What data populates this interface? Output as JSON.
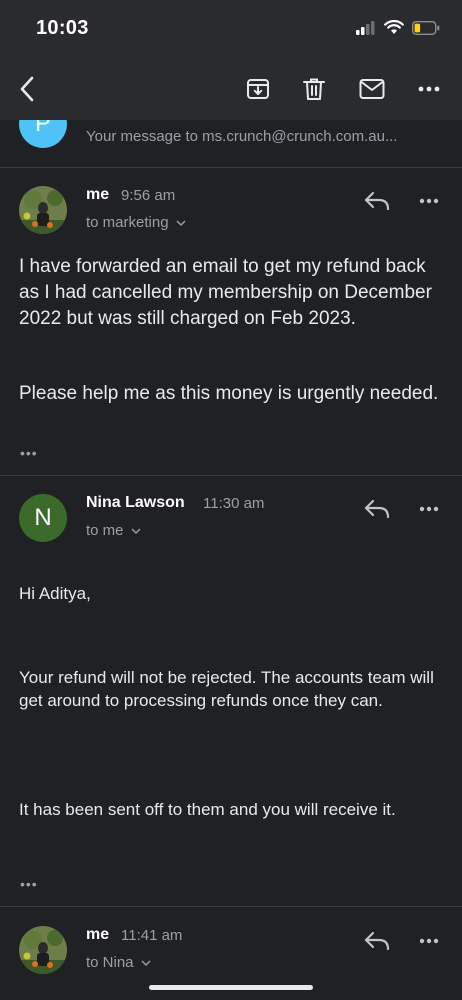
{
  "status": {
    "time": "10:03"
  },
  "toolbar": {
    "back_icon": "chevron-left-icon",
    "archive_icon": "archive-icon",
    "delete_icon": "trash-icon",
    "mark_icon": "mail-icon",
    "more_icon": "more-horizontal-icon"
  },
  "collapsed": {
    "avatar_letter": "P",
    "avatar_color": "#4fc3f7",
    "preview": "Your message to ms.crunch@crunch.com.au..."
  },
  "messages": [
    {
      "sender": "me",
      "time": "9:56 am",
      "to": "to marketing",
      "paragraphs": [
        "I have forwarded an email to get my refund back as I had cancelled my membership on December 2022 but was still charged on Feb 2023.",
        "Please help me as this money is urgently needed."
      ],
      "ellipsis": "•••"
    },
    {
      "sender": "Nina Lawson",
      "avatar_letter": "N",
      "avatar_color": "#3a6b2a",
      "time": "11:30 am",
      "to": "to me",
      "paragraphs": [
        "Hi Aditya,",
        "Your refund will not be rejected. The accounts team will get around to processing refunds once they can.",
        "It has been sent off to them and you will receive it."
      ],
      "ellipsis": "•••"
    },
    {
      "sender": "me",
      "time": "11:41 am",
      "to": "to Nina"
    }
  ],
  "actions": {
    "more_label": "•••"
  }
}
